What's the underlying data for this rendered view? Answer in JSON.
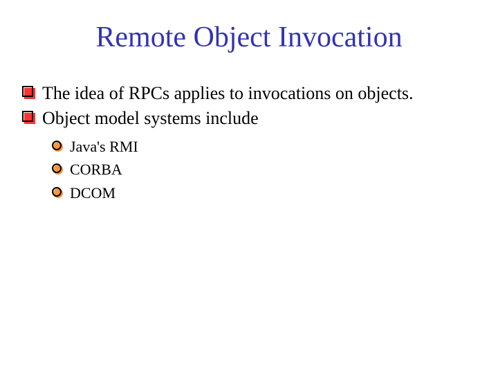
{
  "slide": {
    "title": "Remote Object Invocation",
    "bullets": [
      {
        "text": "The idea of RPCs applies to invocations on objects."
      },
      {
        "text": "Object model systems include"
      }
    ],
    "subbullets": [
      {
        "text": "Java's RMI"
      },
      {
        "text": "CORBA"
      },
      {
        "text": "DCOM"
      }
    ]
  }
}
